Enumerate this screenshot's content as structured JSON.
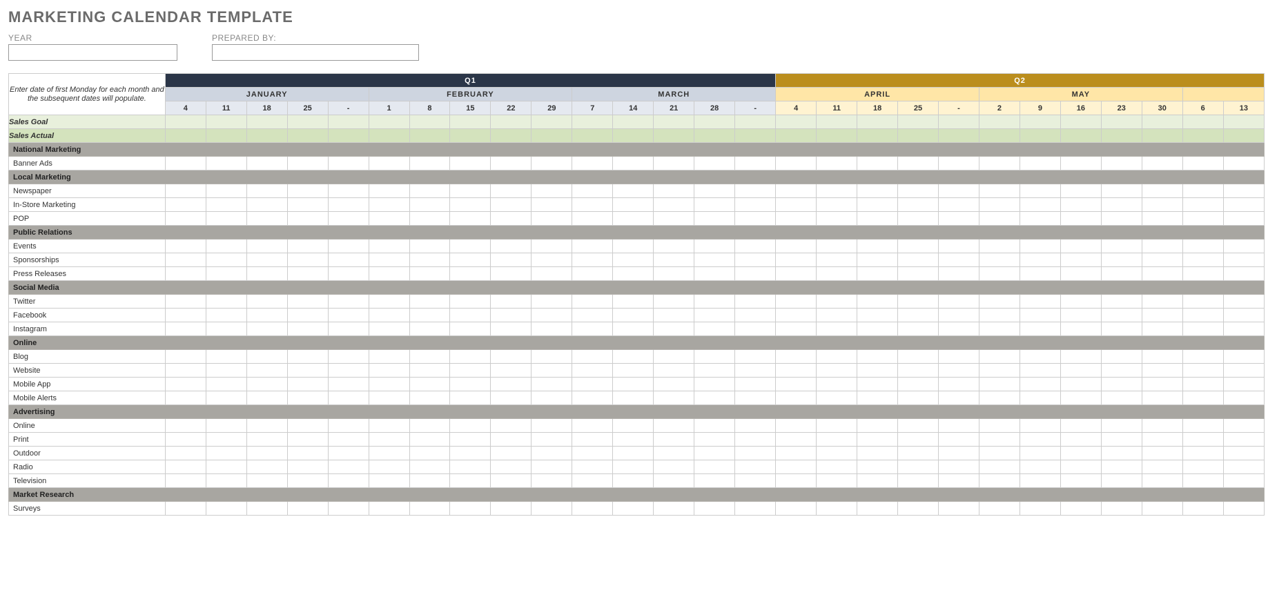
{
  "title": "MARKETING CALENDAR TEMPLATE",
  "meta": {
    "year_label": "YEAR",
    "year_value": "",
    "prepared_label": "PREPARED BY:",
    "prepared_value": ""
  },
  "hint": "Enter date of first Monday for each month and the subsequent dates will populate.",
  "quarters": [
    {
      "id": "q1",
      "label": "Q1",
      "months": [
        {
          "label": "JANUARY",
          "weeks": [
            "4",
            "11",
            "18",
            "25",
            "-"
          ]
        },
        {
          "label": "FEBRUARY",
          "weeks": [
            "1",
            "8",
            "15",
            "22",
            "29"
          ]
        },
        {
          "label": "MARCH",
          "weeks": [
            "7",
            "14",
            "21",
            "28",
            "-"
          ]
        }
      ]
    },
    {
      "id": "q2",
      "label": "Q2",
      "months": [
        {
          "label": "APRIL",
          "weeks": [
            "4",
            "11",
            "18",
            "25",
            "-"
          ]
        },
        {
          "label": "MAY",
          "weeks": [
            "2",
            "9",
            "16",
            "23",
            "30"
          ]
        },
        {
          "label": "JUNE_PARTIAL",
          "hidden_label": true,
          "weeks": [
            "6",
            "13"
          ]
        }
      ]
    }
  ],
  "rows": [
    {
      "type": "sales-goal",
      "label": "Sales Goal"
    },
    {
      "type": "sales-actual",
      "label": "Sales Actual"
    },
    {
      "type": "section",
      "label": "National Marketing"
    },
    {
      "type": "item",
      "label": "Banner Ads"
    },
    {
      "type": "section",
      "label": "Local Marketing"
    },
    {
      "type": "item",
      "label": "Newspaper"
    },
    {
      "type": "item",
      "label": "In-Store Marketing"
    },
    {
      "type": "item",
      "label": "POP"
    },
    {
      "type": "section",
      "label": "Public Relations"
    },
    {
      "type": "item",
      "label": "Events"
    },
    {
      "type": "item",
      "label": "Sponsorships"
    },
    {
      "type": "item",
      "label": "Press Releases"
    },
    {
      "type": "section",
      "label": "Social Media"
    },
    {
      "type": "item",
      "label": "Twitter"
    },
    {
      "type": "item",
      "label": "Facebook"
    },
    {
      "type": "item",
      "label": "Instagram"
    },
    {
      "type": "section",
      "label": "Online"
    },
    {
      "type": "item",
      "label": "Blog"
    },
    {
      "type": "item",
      "label": "Website"
    },
    {
      "type": "item",
      "label": "Mobile App"
    },
    {
      "type": "item",
      "label": "Mobile Alerts"
    },
    {
      "type": "section",
      "label": "Advertising"
    },
    {
      "type": "item",
      "label": "Online"
    },
    {
      "type": "item",
      "label": "Print"
    },
    {
      "type": "item",
      "label": "Outdoor"
    },
    {
      "type": "item",
      "label": "Radio"
    },
    {
      "type": "item",
      "label": "Television"
    },
    {
      "type": "section",
      "label": "Market Research"
    },
    {
      "type": "item",
      "label": "Surveys"
    }
  ]
}
